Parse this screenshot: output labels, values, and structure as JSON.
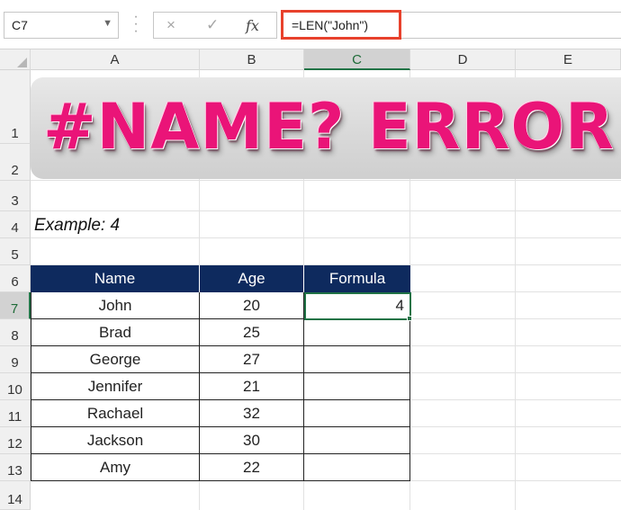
{
  "formula_bar": {
    "name_box": "C7",
    "formula": "=LEN(\"John\")",
    "cancel_icon": "×",
    "enter_icon": "✓",
    "fx_label": "fx"
  },
  "columns": [
    "A",
    "B",
    "C",
    "D",
    "E"
  ],
  "rows": [
    "1",
    "2",
    "3",
    "4",
    "5",
    "6",
    "7",
    "8",
    "9",
    "10",
    "11",
    "12",
    "13",
    "14"
  ],
  "selected_cell": "C7",
  "banner": {
    "title": "#NAME? ERROR"
  },
  "example_label": "Example: 4",
  "table": {
    "headers": [
      "Name",
      "Age",
      "Formula"
    ],
    "rows": [
      {
        "name": "John",
        "age": "20",
        "formula": "4"
      },
      {
        "name": "Brad",
        "age": "25",
        "formula": ""
      },
      {
        "name": "George",
        "age": "27",
        "formula": ""
      },
      {
        "name": "Jennifer",
        "age": "21",
        "formula": ""
      },
      {
        "name": "Rachael",
        "age": "32",
        "formula": ""
      },
      {
        "name": "Jackson",
        "age": "30",
        "formula": ""
      },
      {
        "name": "Amy",
        "age": "22",
        "formula": ""
      }
    ]
  },
  "colors": {
    "header_bg": "#0e2a5e",
    "banner_text": "#ea1478",
    "formula_highlight": "#e8412c",
    "selection": "#217346"
  }
}
